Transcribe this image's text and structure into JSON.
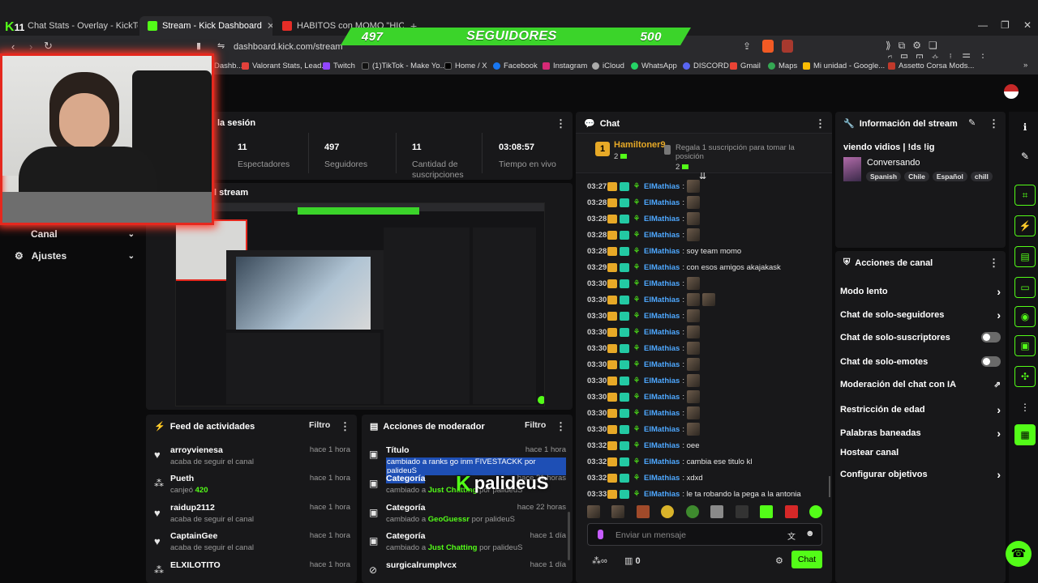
{
  "browser": {
    "tabs": [
      {
        "title": "Chat Stats - Overlay - KickTools"
      },
      {
        "title": "Stream - Kick Dashboard"
      },
      {
        "title": "HABITOS con MOMO \"HICE UN"
      }
    ],
    "url": "dashboard.kick.com/stream",
    "bookmarks": [
      "Dashb...",
      "Valorant Stats, Lead...",
      "Twitch",
      "(1)TikTok - Make Yo...",
      "Home / X",
      "Facebook",
      "Instagram",
      "iCloud",
      "WhatsApp",
      "DISCORD",
      "Gmail",
      "Maps",
      "Mi unidad - Google...",
      "Assetto Corsa Mods..."
    ]
  },
  "overlay": {
    "left": "497",
    "label": "SEGUIDORES",
    "right": "500"
  },
  "left_nav": {
    "canal": "Canal",
    "ajustes": "Ajustes"
  },
  "session": {
    "title": "la sesión",
    "stats": [
      {
        "value": "11",
        "label": "Espectadores"
      },
      {
        "value": "497",
        "label": "Seguidores"
      },
      {
        "value": "11",
        "label": "Cantidad de suscripciones"
      },
      {
        "value": "03:08:57",
        "label": "Tiempo en vivo"
      }
    ]
  },
  "stream_preview": {
    "title": "l stream"
  },
  "feed": {
    "title": "Feed de actividades",
    "filter": "Filtro",
    "items": [
      {
        "name": "arroyvienesa",
        "sub": "acaba de seguir el canal",
        "time": "hace 1 hora"
      },
      {
        "name": "Pueth",
        "sub": "canjeó",
        "amount": "420",
        "time": "hace 1 hora"
      },
      {
        "name": "raidup2112",
        "sub": "acaba de seguir el canal",
        "time": "hace 1 hora"
      },
      {
        "name": "CaptainGee",
        "sub": "acaba de seguir el canal",
        "time": "hace 1 hora"
      },
      {
        "name": "ELXILOTITO",
        "sub": "",
        "time": "hace 1 hora"
      }
    ]
  },
  "mod": {
    "title": "Acciones de moderador",
    "filter": "Filtro",
    "items": [
      {
        "name": "Título",
        "sub": "cambiado a ranks go inm FIVESTACKK por palideuS",
        "time": "hace 1 hora"
      },
      {
        "name": "Categoría",
        "sub1": "cambiado a",
        "cat": "Just Chatting",
        "sub2": "por palideuS",
        "time": "hace 21 horas"
      },
      {
        "name": "Categoría",
        "sub1": "cambiado a",
        "cat": "GeoGuessr",
        "sub2": "por palideuS",
        "time": "hace 22 horas"
      },
      {
        "name": "Categoría",
        "sub1": "cambiado a",
        "cat": "Just Chatting",
        "sub2": "por palideuS",
        "time": "hace 1 día"
      },
      {
        "name": "surgicalrumplvcx",
        "sub": "",
        "time": "hace 1 día"
      }
    ]
  },
  "watermark": "palideuS",
  "chat": {
    "title": "Chat",
    "top_user": "Hamiltoner9",
    "top_count": "2",
    "top_rank": "1",
    "gift_text": "Regala 1 suscripción para tomar la posición",
    "gift_count": "2",
    "messages": [
      {
        "time": "03:27",
        "user": "ElMathias",
        "text": ":"
      },
      {
        "time": "03:28",
        "user": "ElMathias",
        "text": ":"
      },
      {
        "time": "03:28",
        "user": "ElMathias",
        "text": ":"
      },
      {
        "time": "03:28",
        "user": "ElMathias",
        "text": ":"
      },
      {
        "time": "03:28",
        "user": "ElMathias",
        "text": ": soy team momo"
      },
      {
        "time": "03:29",
        "user": "ElMathias",
        "text": ": con esos amigos akajakask"
      },
      {
        "time": "03:30",
        "user": "ElMathias",
        "text": ":"
      },
      {
        "time": "03:30",
        "user": "ElMathias",
        "text": ":"
      },
      {
        "time": "03:30",
        "user": "ElMathias",
        "text": ":"
      },
      {
        "time": "03:30",
        "user": "ElMathias",
        "text": ":"
      },
      {
        "time": "03:30",
        "user": "ElMathias",
        "text": ":"
      },
      {
        "time": "03:30",
        "user": "ElMathias",
        "text": ":"
      },
      {
        "time": "03:30",
        "user": "ElMathias",
        "text": ":"
      },
      {
        "time": "03:30",
        "user": "ElMathias",
        "text": ":"
      },
      {
        "time": "03:30",
        "user": "ElMathias",
        "text": ":"
      },
      {
        "time": "03:30",
        "user": "ElMathias",
        "text": ":"
      },
      {
        "time": "03:32",
        "user": "ElMathias",
        "text": ": oee"
      },
      {
        "time": "03:32",
        "user": "ElMathias",
        "text": ": cambia ese titulo kl"
      },
      {
        "time": "03:32",
        "user": "ElMathias",
        "text": ": xdxd"
      },
      {
        "time": "03:33",
        "user": "ElMathias",
        "text": ": le ta robando la pega a la antonia"
      }
    ],
    "input_placeholder": "Enviar un mensaje",
    "viewers": "0",
    "send": "Chat"
  },
  "stream_info": {
    "title": "Información del stream",
    "stream_title": "viendo vidios | !ds !ig",
    "category": "Conversando",
    "tags": [
      "Spanish",
      "Chile",
      "Español",
      "chill"
    ]
  },
  "channel_actions": {
    "title": "Acciones de canal",
    "items": [
      {
        "label": "Modo lento",
        "kind": "arrow"
      },
      {
        "label": "Chat de solo-seguidores",
        "kind": "arrow"
      },
      {
        "label": "Chat de solo-suscriptores",
        "kind": "toggle"
      },
      {
        "label": "Chat de solo-emotes",
        "kind": "toggle"
      },
      {
        "label": "Moderación del chat con IA",
        "kind": "ext"
      },
      {
        "label": "Restricción de edad",
        "kind": "arrow"
      },
      {
        "label": "Palabras baneadas",
        "kind": "arrow"
      },
      {
        "label": "Hostear canal",
        "kind": "none"
      },
      {
        "label": "Configurar objetivos",
        "kind": "arrow"
      }
    ]
  },
  "colors": {
    "accent": "#53fc18",
    "cam_border": "#e5281e",
    "username": "#4ea8ff"
  }
}
